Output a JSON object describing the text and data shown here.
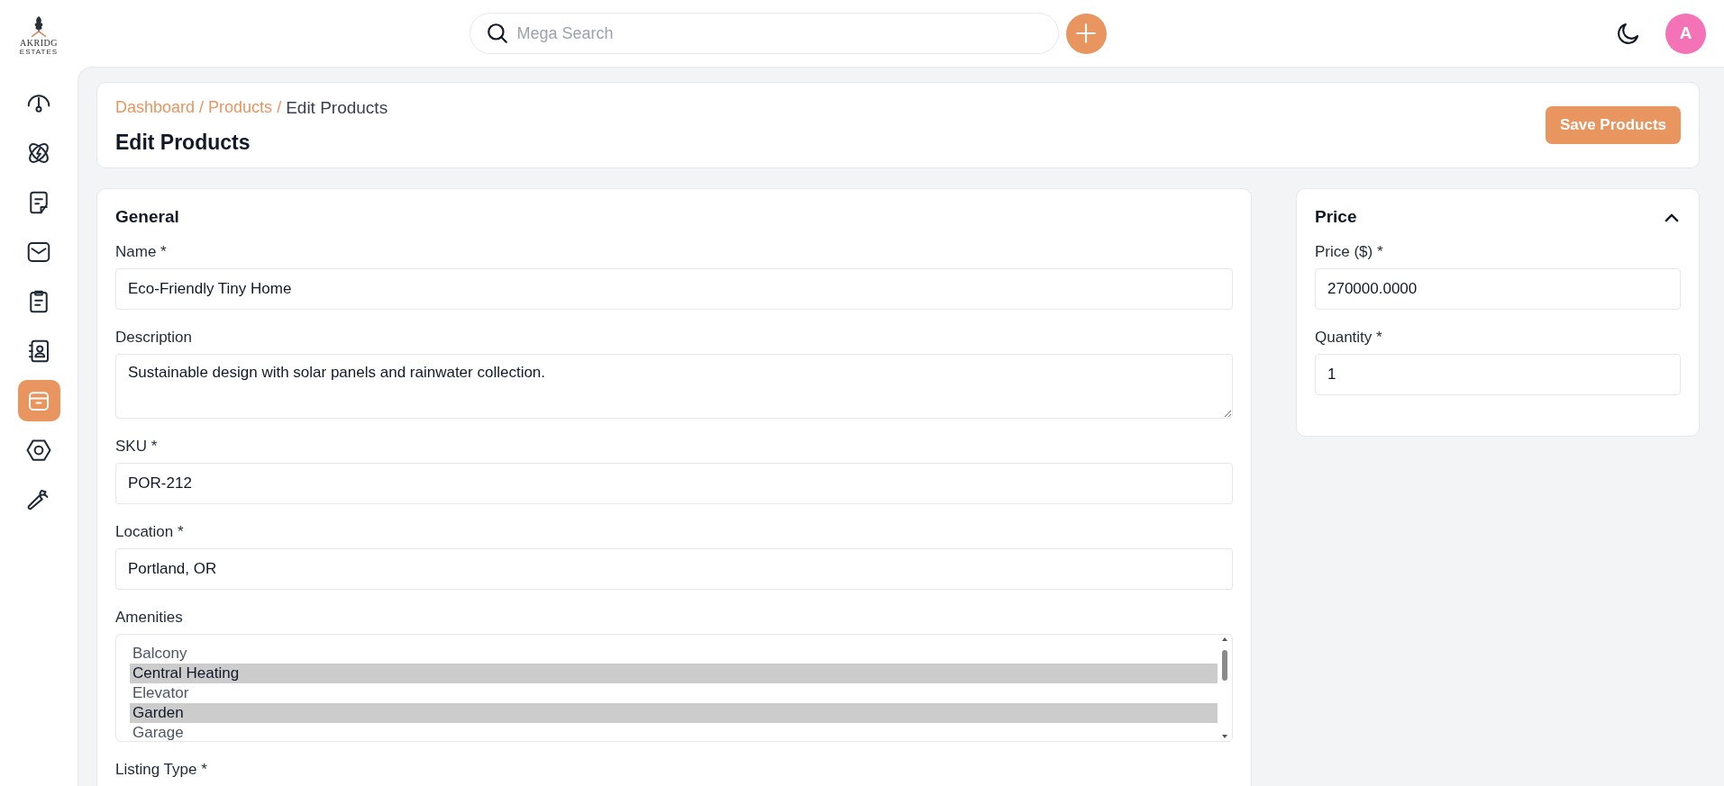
{
  "header": {
    "logo_name": "AKRIDG",
    "logo_sub": "ESTATES",
    "search": {
      "placeholder": "Mega Search"
    },
    "avatar": "A"
  },
  "sidebar": {
    "items": [
      {
        "kind": "gauge",
        "selected": false
      },
      {
        "kind": "link",
        "selected": false
      },
      {
        "kind": "note",
        "selected": false
      },
      {
        "kind": "envelope",
        "selected": false
      },
      {
        "kind": "clipboard",
        "selected": false
      },
      {
        "kind": "contacts",
        "selected": false
      },
      {
        "kind": "archive",
        "selected": true
      },
      {
        "kind": "nut",
        "selected": false
      },
      {
        "kind": "wrench",
        "selected": false
      }
    ]
  },
  "breadcrumb": [
    {
      "label": "Dashboard",
      "current": false,
      "separator": "/"
    },
    {
      "label": "Products",
      "current": false,
      "separator": "/"
    },
    {
      "label": "Edit Products",
      "current": true
    }
  ],
  "page_title": "Edit Products",
  "save_button": "Save Products",
  "general": {
    "title": "General",
    "fields": [
      {
        "kind": "text",
        "label": "Name *",
        "value": "Eco-Friendly Tiny Home"
      },
      {
        "kind": "textarea",
        "label": "Description",
        "value": "Sustainable design with solar panels and rainwater collection."
      },
      {
        "kind": "text",
        "label": "SKU *",
        "value": "POR-212"
      },
      {
        "kind": "text",
        "label": "Location *",
        "value": "Portland, OR"
      },
      {
        "kind": "multiselect",
        "label": "Amenities",
        "options": [
          {
            "label": "Balcony",
            "selected": false
          },
          {
            "label": "Central Heating",
            "selected": true
          },
          {
            "label": "Elevator",
            "selected": false
          },
          {
            "label": "Garden",
            "selected": true
          },
          {
            "label": "Garage",
            "selected": false
          }
        ]
      },
      {
        "kind": "label",
        "label": "Listing Type *"
      }
    ]
  },
  "price": {
    "title": "Price",
    "expanded": true,
    "fields": [
      {
        "kind": "text",
        "label": "Price ($) *",
        "value": "270000.0000"
      },
      {
        "kind": "text",
        "label": "Quantity *",
        "value": "1"
      }
    ]
  }
}
